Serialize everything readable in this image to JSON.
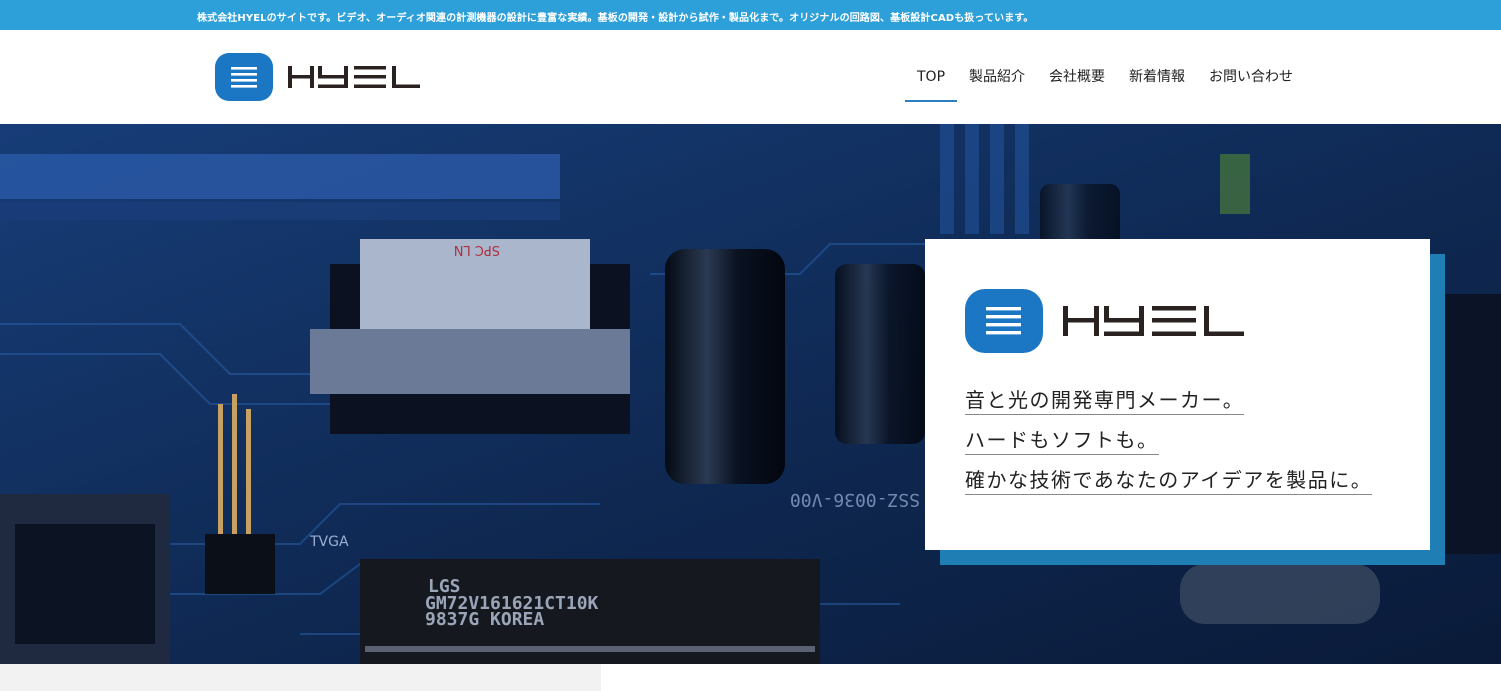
{
  "topbar": {
    "text": "株式会社HYELのサイトです。ビデオ、オーディオ関連の計測機器の設計に豊富な実績。基板の開発・設計から試作・製品化まで。オリジナルの回路図、基板設計CADも扱っています。"
  },
  "header": {
    "logo_text": "HYEL",
    "nav": [
      {
        "label": "TOP",
        "active": true
      },
      {
        "label": "製品紹介",
        "active": false
      },
      {
        "label": "会社概要",
        "active": false
      },
      {
        "label": "新着情報",
        "active": false
      },
      {
        "label": "お問い合わせ",
        "active": false
      }
    ]
  },
  "hero": {
    "card_logo_text": "HYEL",
    "taglines": [
      "音と光の開発専門メーカー。",
      "ハードもソフトも。",
      "確かな技術であなたのアイデアを製品に。"
    ],
    "chip_lines": [
      "LGS",
      "GM72V161621CT10K",
      "9837G KOREA"
    ],
    "board_labels": [
      "TVGA",
      "SSZ-0036-V00",
      "SPC LN"
    ]
  },
  "colors": {
    "accent": "#2d9fd9",
    "brand_blue": "#1b76c3",
    "card_shadow": "#1f7fb5",
    "nav_underline": "#2d7fc0"
  }
}
